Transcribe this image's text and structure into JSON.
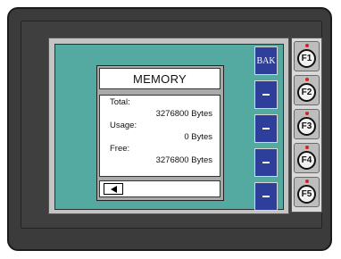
{
  "softkeys": {
    "bak_label": "BAK"
  },
  "dialog": {
    "title": "MEMORY",
    "total_label": "Total:",
    "total_value": "3276800 Bytes",
    "usage_label": "Usage:",
    "usage_value": "0 Bytes",
    "free_label": "Free:",
    "free_value": "3276800 Bytes"
  },
  "function_keys": [
    "F1",
    "F2",
    "F3",
    "F4",
    "F5"
  ],
  "icons": {
    "back": "left-triangle-icon",
    "softkey_dash": "dash-icon",
    "indicator": "red-led-indicator"
  },
  "colors": {
    "screen_background": "#54a9a0",
    "softkey": "#2d3f9a",
    "bezel": "#3b3b3b",
    "led": "#d52222"
  }
}
